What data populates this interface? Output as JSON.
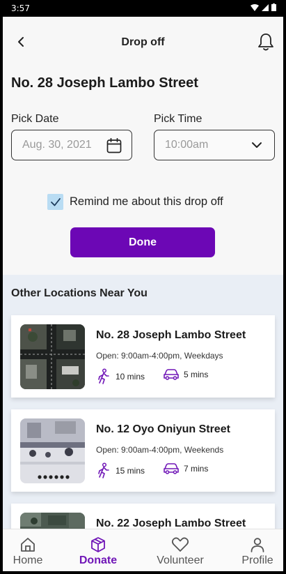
{
  "status_bar": {
    "time": "3:57"
  },
  "header": {
    "title": "Drop off"
  },
  "address": "No. 28 Joseph Lambo Street",
  "pick_date": {
    "label": "Pick Date",
    "value": "Aug. 30, 2021"
  },
  "pick_time": {
    "label": "Pick Time",
    "value": "10:00am"
  },
  "reminder": {
    "label": "Remind me about this drop off",
    "checked": true
  },
  "done_label": "Done",
  "other_locations": {
    "title": "Other Locations Near You",
    "items": [
      {
        "name": "No. 28 Joseph Lambo Street",
        "hours": "Open: 9:00am-4:00pm, Weekdays",
        "walk": "10 mins",
        "drive": "5 mins"
      },
      {
        "name": "No. 12 Oyo Oniyun Street",
        "hours": "Open: 9:00am-4:00pm, Weekends",
        "walk": "15 mins",
        "drive": "7 mins"
      },
      {
        "name": "No. 22 Joseph Lambo Street",
        "hours": "",
        "walk": "",
        "drive": ""
      }
    ]
  },
  "nav": {
    "home": "Home",
    "donate": "Donate",
    "volunteer": "Volunteer",
    "profile": "Profile",
    "active": "donate"
  },
  "colors": {
    "primary": "#6c07b5",
    "checkbox": "#b9dcf3",
    "section_bg": "#e9eef5"
  }
}
